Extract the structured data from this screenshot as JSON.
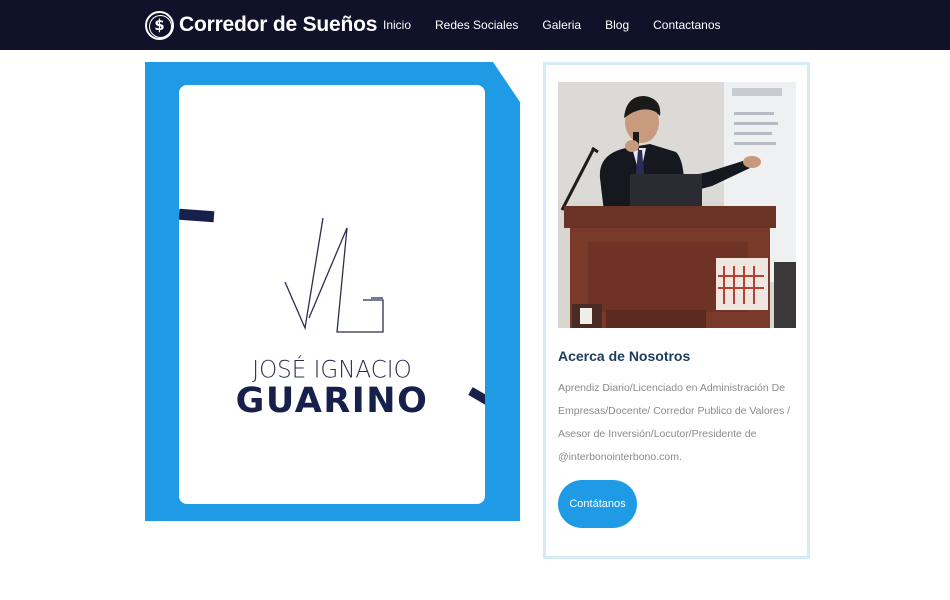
{
  "brand": {
    "logo_symbol": "$",
    "name": "Corredor de Sueños"
  },
  "nav": [
    "Inicio",
    "Redes Sociales",
    "Galeria",
    "Blog",
    "Contactanos"
  ],
  "hero": {
    "logo_line1": "JOSÉ IGNACIO",
    "logo_line2": "GUARINO",
    "monogram_icon": "jig-monogram-icon"
  },
  "about": {
    "title": "Acerca de Nosotros",
    "text": "Aprendiz Diario/Licenciado en Administración De Empresas/Docente/ Corredor Publico de Valores / Asesor de Inversión/Locutor/Presidente de @interbonointerbono.com.",
    "button": "Contátanos"
  },
  "colors": {
    "navbar": "#10122a",
    "accent": "#1e9be4",
    "logo_navy": "#16204a",
    "title": "#1c3c5c",
    "body_text": "#8a8a8a"
  }
}
